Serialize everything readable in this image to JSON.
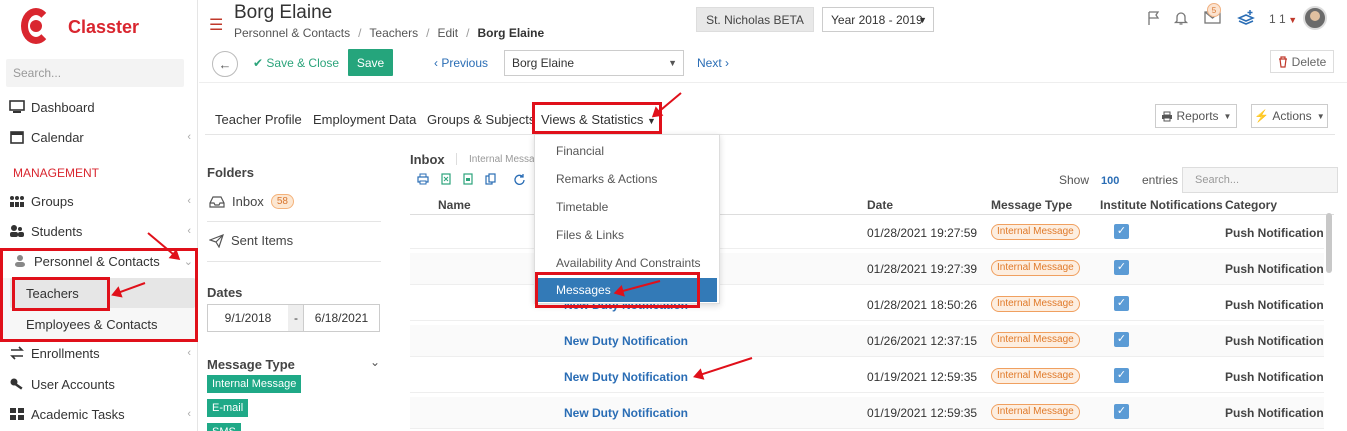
{
  "sidebar": {
    "brand": "Classter",
    "search_placeholder": "Search...",
    "items": {
      "dashboard": "Dashboard",
      "calendar": "Calendar",
      "section": "MANAGEMENT",
      "groups": "Groups",
      "students": "Students",
      "personnel": "Personnel & Contacts",
      "teachers": "Teachers",
      "employees": "Employees & Contacts",
      "enrollments": "Enrollments",
      "user_accounts": "User Accounts",
      "academic_tasks": "Academic Tasks"
    }
  },
  "header": {
    "title": "Borg Elaine",
    "breadcrumb": [
      "Personnel & Contacts",
      "/",
      "Teachers",
      "/",
      "Edit",
      "/",
      "Borg Elaine"
    ],
    "school": "St. Nicholas BETA",
    "year": "Year 2018 - 2019",
    "mail_badge": "5",
    "user_count": "1 1"
  },
  "toolbar": {
    "save_close": "✔ Save & Close",
    "save": "Save",
    "previous": "‹ Previous",
    "teacher": "Borg Elaine",
    "next": "Next ›",
    "delete": "Delete"
  },
  "tabs": [
    "Teacher Profile",
    "Employment Data",
    "Groups & Subjects",
    "Views & Statistics"
  ],
  "buttons": {
    "reports": "Reports",
    "actions": "Actions"
  },
  "menu": [
    "Financial",
    "Remarks & Actions",
    "Timetable",
    "Files & Links",
    "Availability And Constraints",
    "Messages"
  ],
  "folders": {
    "title": "Folders",
    "inbox": "Inbox",
    "inbox_count": "58",
    "sent": "Sent Items",
    "dates_title": "Dates",
    "date_from": "9/1/2018",
    "date_sep": "-",
    "date_to": "6/18/2021",
    "message_type_title": "Message Type",
    "message_types": [
      "Internal Message",
      "E-mail",
      "SMS"
    ]
  },
  "inbox": {
    "title": "Inbox",
    "subtab": "Internal Messa",
    "show_label": "Show",
    "show_value": "100",
    "entries_label": "entries",
    "search_placeholder": "Search...",
    "columns": [
      "Name",
      "Date",
      "Message Type",
      "Institute Notifications",
      "Category"
    ],
    "rows": [
      {
        "name": "",
        "date": "01/28/2021 19:27:59",
        "type": "Internal Message",
        "category": "Push Notification"
      },
      {
        "name": "",
        "date": "01/28/2021 19:27:39",
        "type": "Internal Message",
        "category": "Push Notification"
      },
      {
        "name": "New Duty Notification",
        "date": "01/28/2021 18:50:26",
        "type": "Internal Message",
        "category": "Push Notification"
      },
      {
        "name": "New Duty Notification",
        "date": "01/26/2021 12:37:15",
        "type": "Internal Message",
        "category": "Push Notification"
      },
      {
        "name": "New Duty Notification",
        "date": "01/19/2021 12:59:35",
        "type": "Internal Message",
        "category": "Push Notification"
      },
      {
        "name": "New Duty Notification",
        "date": "01/19/2021 12:59:35",
        "type": "Internal Message",
        "category": "Push Notification"
      }
    ]
  },
  "colors": {
    "brand": "#d9262f",
    "accent": "#25a57c",
    "link": "#2a6db5",
    "highlight": "#e0101a"
  }
}
